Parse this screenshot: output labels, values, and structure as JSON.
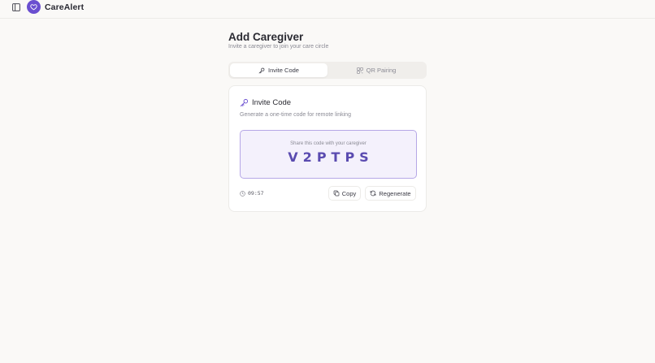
{
  "app": {
    "name": "CareAlert"
  },
  "page": {
    "title": "Add Caregiver",
    "subtitle": "Invite a caregiver to join your care circle"
  },
  "tabs": [
    {
      "label": "Invite Code",
      "icon": "key-icon",
      "active": true
    },
    {
      "label": "QR Pairing",
      "icon": "qr-icon",
      "active": false
    }
  ],
  "card": {
    "title": "Invite Code",
    "description": "Generate a one-time code for remote linking",
    "code_hint": "Share this code with your caregiver",
    "code": "V2PTPS",
    "timer": "09:57",
    "copy_label": "Copy",
    "regenerate_label": "Regenerate"
  },
  "colors": {
    "accent": "#6a4fd0",
    "code_text": "#5a4bb0",
    "code_bg": "#f4f1fc",
    "background": "#faf9f7"
  }
}
